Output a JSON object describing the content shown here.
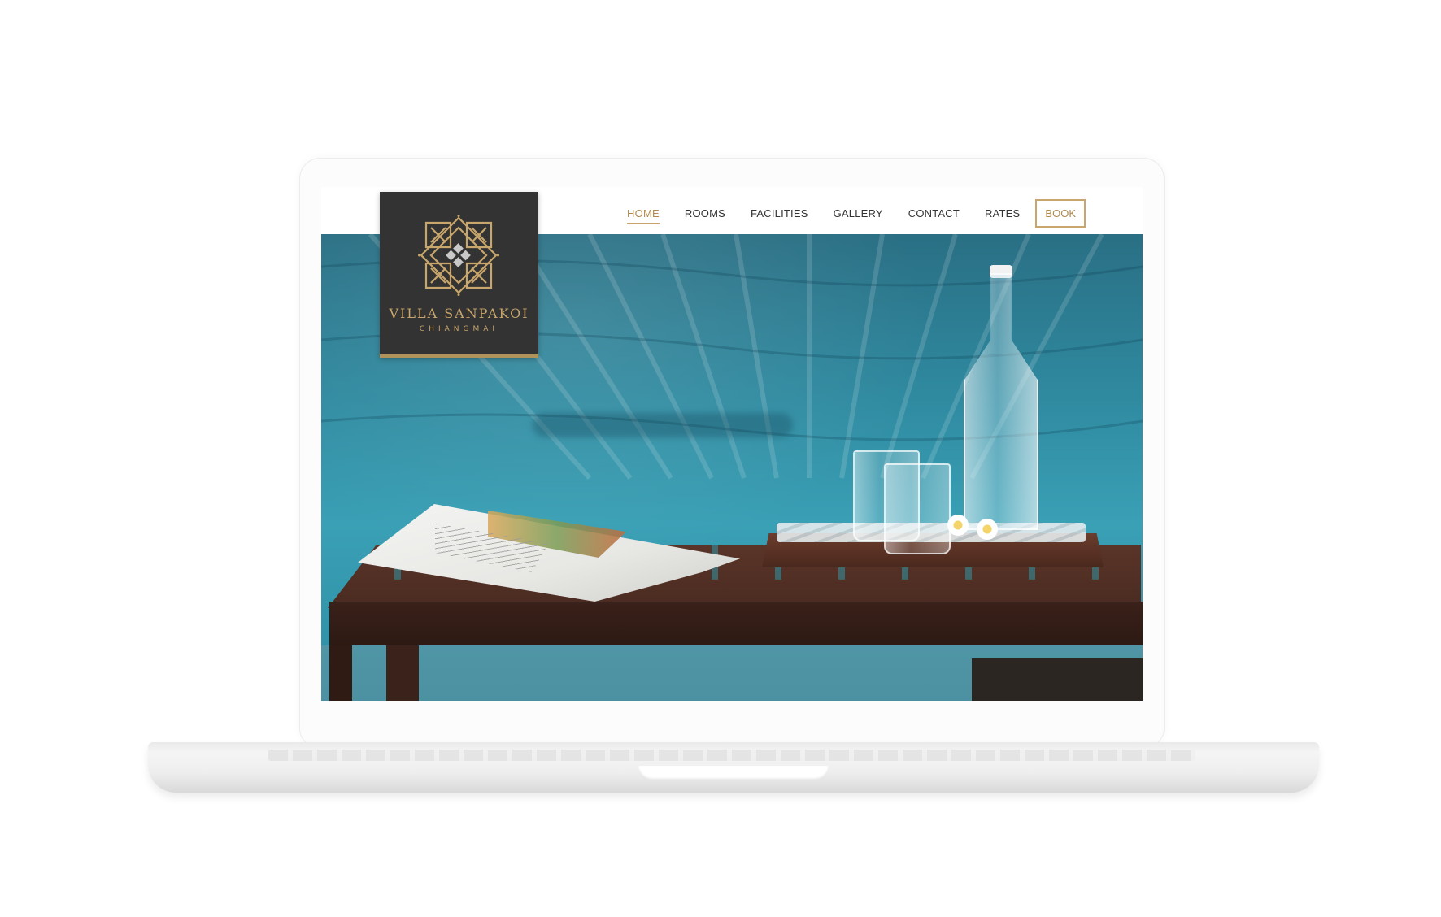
{
  "brand": {
    "name": "VILLA SANPAKOI",
    "subtitle": "CHIANGMAI",
    "gold": "#c9a66b",
    "dark": "#333333"
  },
  "nav": {
    "items": [
      {
        "label": "HOME",
        "active": true
      },
      {
        "label": "ROOMS"
      },
      {
        "label": "FACILITIES"
      },
      {
        "label": "GALLERY"
      },
      {
        "label": "CONTACT"
      },
      {
        "label": "RATES"
      }
    ],
    "book_label": "BOOK"
  },
  "hero": {
    "slide_count": 2,
    "active_slide": 1,
    "accent_dot_color": "#1e73d6"
  }
}
